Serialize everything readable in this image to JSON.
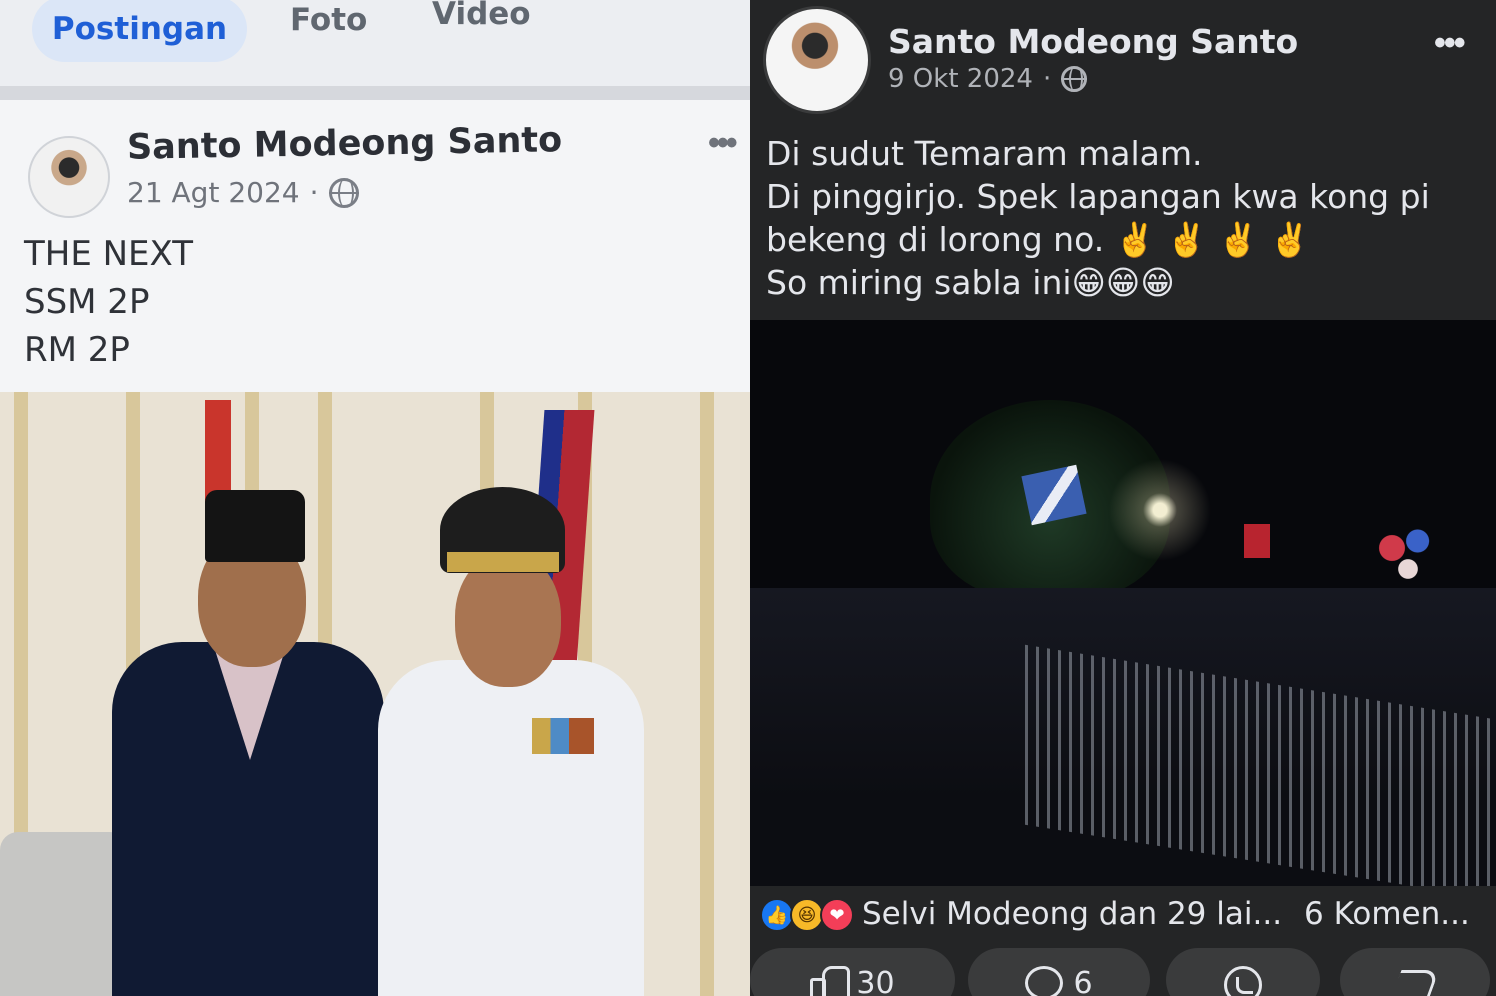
{
  "left_post": {
    "tabs": [
      {
        "label": "Postingan",
        "active": true
      },
      {
        "label": "Foto",
        "active": false
      },
      {
        "label": "Video",
        "active": false
      }
    ],
    "author": "Santo Modeong Santo",
    "date": "21 Agt 2024",
    "more": "•••",
    "text_lines": [
      "THE NEXT",
      " SSM 2P",
      "RM 2P"
    ],
    "photo_icon": "two-officials-photo",
    "privacy_icon": "globe-icon"
  },
  "right_post": {
    "author": "Santo Modeong Santo",
    "date": "9 Okt 2024",
    "more": "•••",
    "privacy_icon": "globe-icon",
    "text_lines": [
      "Di sudut Temaram malam.",
      "Di pinggirjo. Spek lapangan kwa kong pi",
      "bekeng di lorong no. ✌️ ✌️ ✌️ ✌️",
      "So miring sabla ini😁😁😁"
    ],
    "photo_icon": "night-crowd-photo",
    "reactions": {
      "icons": [
        "like-icon",
        "haha-icon",
        "love-icon"
      ],
      "summary": "Selvi Modeong dan 29 lai...",
      "comments": "6 Komen..."
    },
    "actions": {
      "like_count": "30",
      "comment_count": "6"
    }
  },
  "colors": {
    "accent_blue": "#1f5fd6",
    "dark_bg": "#242526",
    "like_blue": "#1877f2",
    "love_red": "#f33e58"
  }
}
